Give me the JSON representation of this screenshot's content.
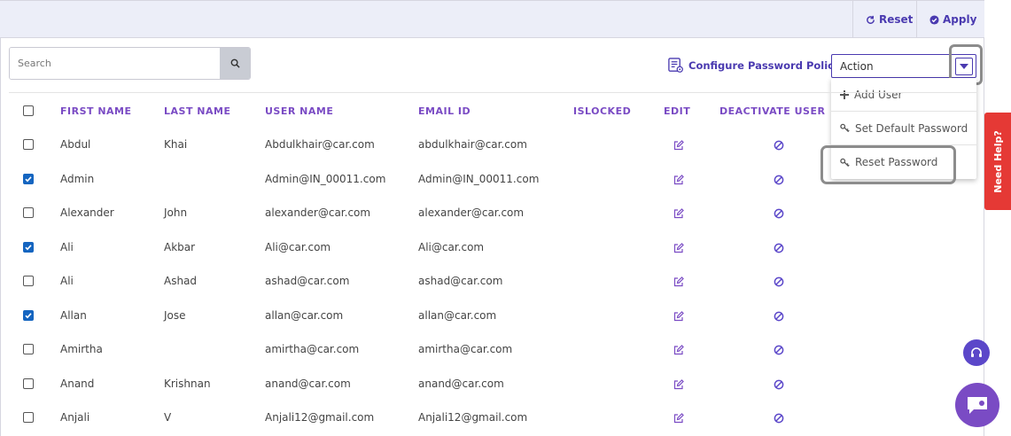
{
  "toolbar": {
    "reset_label": "Reset",
    "apply_label": "Apply"
  },
  "search": {
    "placeholder": "Search",
    "value": ""
  },
  "policy_link": "Configure Password Policy",
  "action_select": {
    "selected": "Action"
  },
  "action_menu": [
    {
      "label": "Add User",
      "icon": "plus-icon"
    },
    {
      "label": "Set Default Password",
      "icon": "key-icon"
    },
    {
      "label": "Reset Password",
      "icon": "key-icon"
    }
  ],
  "table": {
    "headers": [
      "FIRST NAME",
      "LAST NAME",
      "USER NAME",
      "EMAIL ID",
      "ISLOCKED",
      "EDIT",
      "DEACTIVATE USER"
    ],
    "rows": [
      {
        "checked": false,
        "first": "Abdul",
        "last": "Khai",
        "user": "Abdulkhair@car.com",
        "email": "abdulkhair@car.com"
      },
      {
        "checked": true,
        "first": "Admin",
        "last": "",
        "user": "Admin@IN_00011.com",
        "email": "Admin@IN_00011.com"
      },
      {
        "checked": false,
        "first": "Alexander",
        "last": "John",
        "user": "alexander@car.com",
        "email": "alexander@car.com"
      },
      {
        "checked": true,
        "first": "Ali",
        "last": "Akbar",
        "user": "Ali@car.com",
        "email": "Ali@car.com"
      },
      {
        "checked": false,
        "first": "Ali",
        "last": "Ashad",
        "user": "ashad@car.com",
        "email": "ashad@car.com"
      },
      {
        "checked": true,
        "first": "Allan",
        "last": "Jose",
        "user": "allan@car.com",
        "email": "allan@car.com"
      },
      {
        "checked": false,
        "first": "Amirtha",
        "last": "",
        "user": "amirtha@car.com",
        "email": "amirtha@car.com"
      },
      {
        "checked": false,
        "first": "Anand",
        "last": "Krishnan",
        "user": "anand@car.com",
        "email": "anand@car.com"
      },
      {
        "checked": false,
        "first": "Anjali",
        "last": "V",
        "user": "Anjali12@gmail.com",
        "email": "Anjali12@gmail.com"
      }
    ]
  },
  "help_tab": "Need Help?",
  "colors": {
    "accent": "#4a3ab0",
    "header_text": "#7a4bc4",
    "checkbox": "#1565c0",
    "help": "#e53935"
  }
}
